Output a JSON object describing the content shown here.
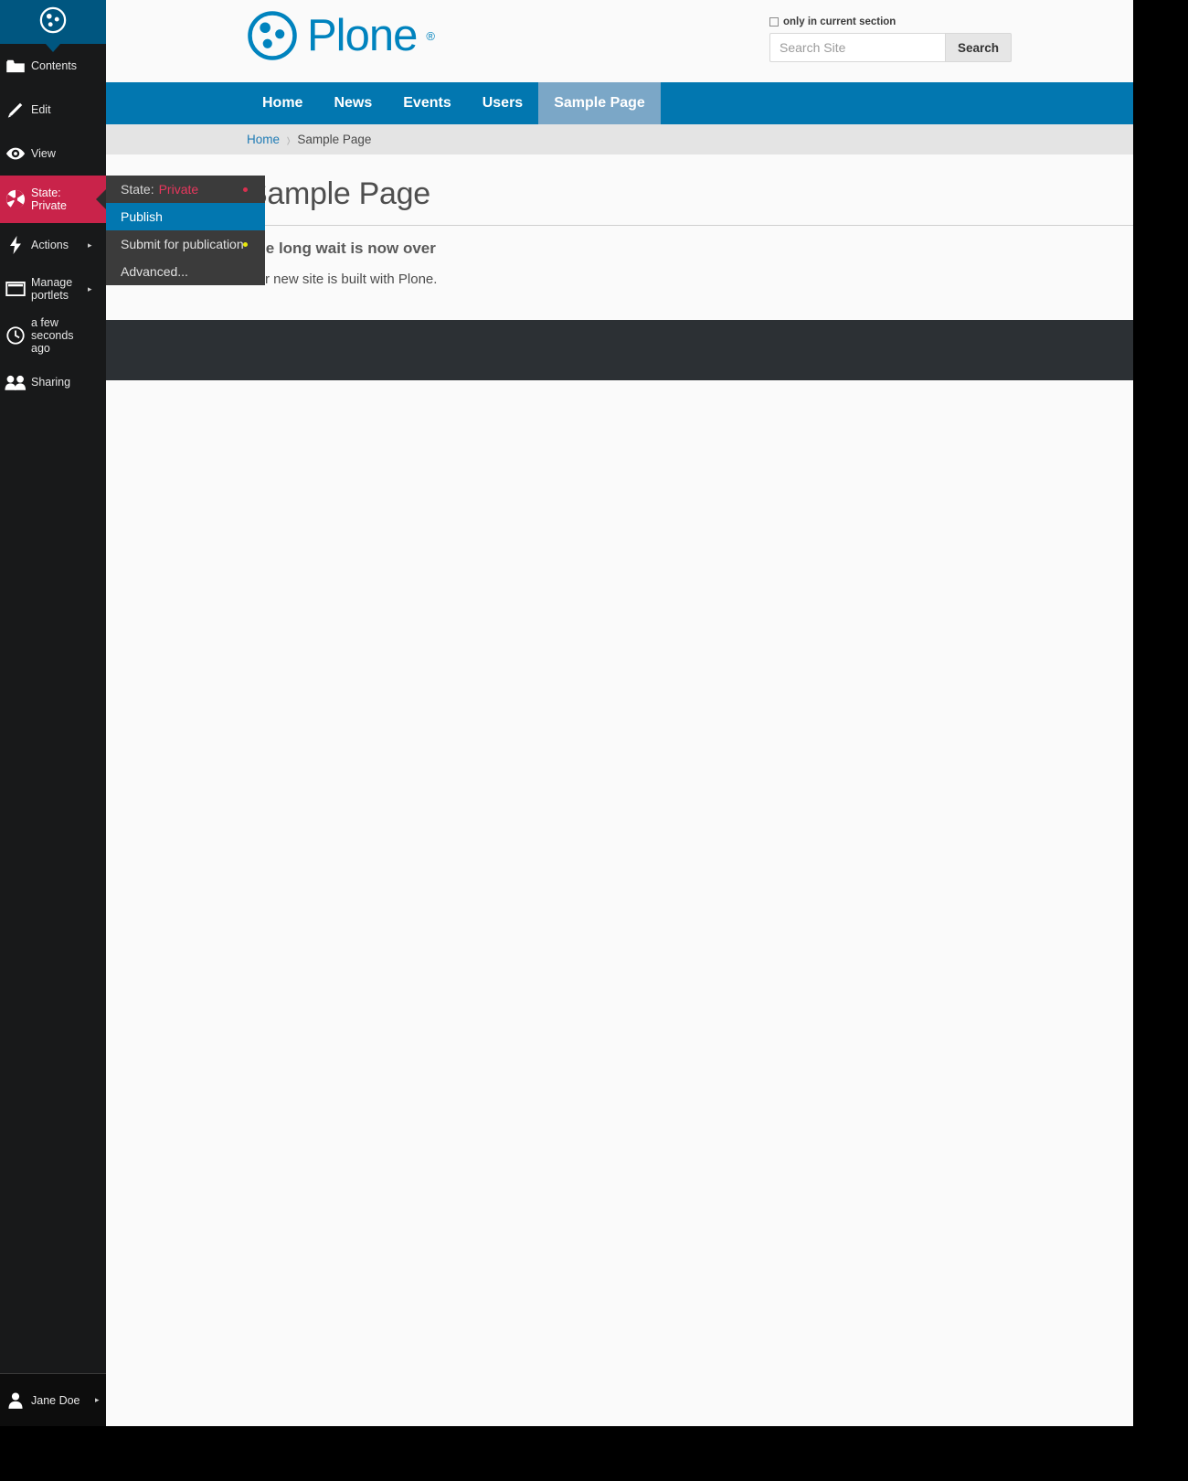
{
  "toolbar": {
    "logo_icon": "plone-logo-icon",
    "items": [
      {
        "label": "Contents",
        "icon": "folder-icon",
        "has_submenu": false,
        "state": false
      },
      {
        "label": "Edit",
        "icon": "pencil-icon",
        "has_submenu": false,
        "state": false
      },
      {
        "label": "View",
        "icon": "eye-icon",
        "has_submenu": false,
        "state": false
      },
      {
        "label": "State: Private",
        "icon": "workflow-icon",
        "has_submenu": false,
        "state": true
      },
      {
        "label": "Actions",
        "icon": "lightning-icon",
        "has_submenu": true,
        "state": false
      },
      {
        "label": "Manage portlets",
        "icon": "portlet-icon",
        "has_submenu": true,
        "state": false
      },
      {
        "label": "a few seconds ago",
        "icon": "clock-icon",
        "has_submenu": false,
        "state": false
      },
      {
        "label": "Sharing",
        "icon": "users-icon",
        "has_submenu": false,
        "state": false
      }
    ],
    "user": {
      "name": "Jane Doe",
      "icon": "person-icon",
      "arrow": "▸"
    },
    "submenu_arrow": "▸",
    "state_color": "#c9234a"
  },
  "workflow_menu": {
    "state_label": "State:",
    "state_value": "Private",
    "items": [
      {
        "label": "Publish",
        "active": true,
        "dot": ""
      },
      {
        "label": "Submit for publication",
        "active": false,
        "dot": "yellow"
      },
      {
        "label": "Advanced...",
        "active": false,
        "dot": ""
      }
    ],
    "header_dot": "red"
  },
  "header": {
    "logo_text": "Plone",
    "logo_registered": "®",
    "logo_color": "#0083be"
  },
  "search": {
    "section_label": "only in current section",
    "section_checked": false,
    "placeholder": "Search Site",
    "value": "",
    "button_label": "Search"
  },
  "nav": {
    "items": [
      {
        "label": "Home",
        "active": false
      },
      {
        "label": "News",
        "active": false
      },
      {
        "label": "Events",
        "active": false
      },
      {
        "label": "Users",
        "active": false
      },
      {
        "label": "Sample Page",
        "active": true
      }
    ],
    "bg_color": "#0277b0",
    "active_bg_color": "#7ba7c7"
  },
  "breadcrumb": {
    "home": "Home",
    "separator": "›",
    "current": "Sample Page"
  },
  "document": {
    "title": "Sample Page",
    "description": "The long wait is now over",
    "body": "Our new site is built with Plone."
  }
}
